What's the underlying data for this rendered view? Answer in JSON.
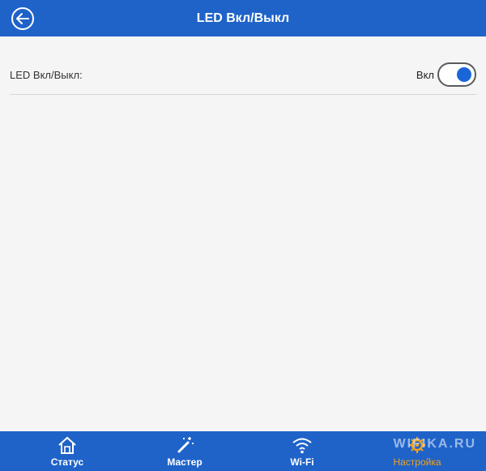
{
  "header": {
    "title": "LED Вкл/Выкл",
    "back_icon": "back-arrow-icon"
  },
  "setting": {
    "label": "LED Вкл/Выкл:",
    "state_label": "Вкл",
    "enabled": true,
    "accent": "#1a66d9"
  },
  "bottom_nav": {
    "items": [
      {
        "label": "Статус",
        "icon": "home-icon"
      },
      {
        "label": "Мастер",
        "icon": "magic-wand-icon"
      },
      {
        "label": "Wi-Fi",
        "icon": "wifi-icon"
      },
      {
        "label": "Настройка",
        "icon": "settings-gear-icon",
        "active": true
      }
    ],
    "watermark": "WIFIKA.RU"
  },
  "colors": {
    "primary": "#1f63c9",
    "background": "#f5f5f5",
    "active_nav": "#f0a11e"
  }
}
